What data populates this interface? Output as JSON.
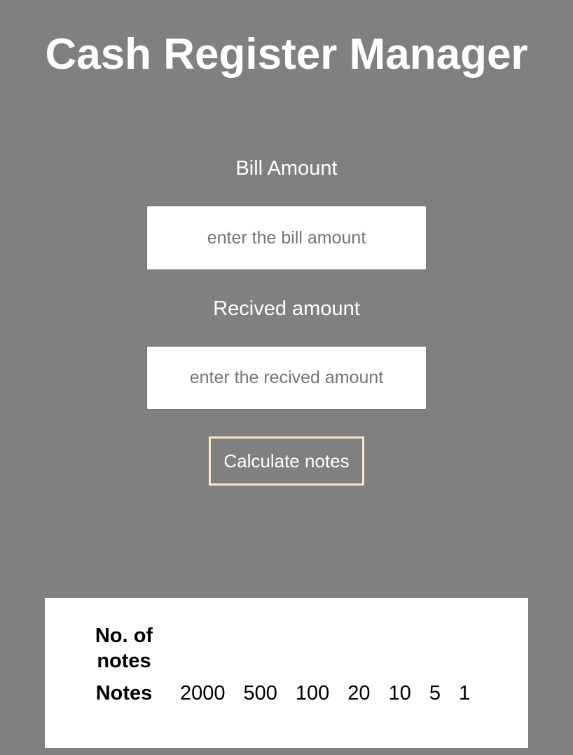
{
  "header": {
    "title": "Cash Register Manager"
  },
  "bill": {
    "label": "Bill Amount",
    "placeholder": "enter the bill amount",
    "value": ""
  },
  "received": {
    "label": "Recived amount",
    "placeholder": "enter the recived amount",
    "value": ""
  },
  "actions": {
    "calculate_label": "Calculate notes"
  },
  "output_table": {
    "count_header": "No. of notes",
    "notes_header": "Notes",
    "denominations": [
      "2000",
      "500",
      "100",
      "20",
      "10",
      "5",
      "1"
    ],
    "counts": [
      "",
      "",
      "",
      "",
      "",
      "",
      ""
    ]
  },
  "colors": {
    "background": "#808080",
    "button_border": "#ffe4c4",
    "panel": "#ffffff"
  }
}
